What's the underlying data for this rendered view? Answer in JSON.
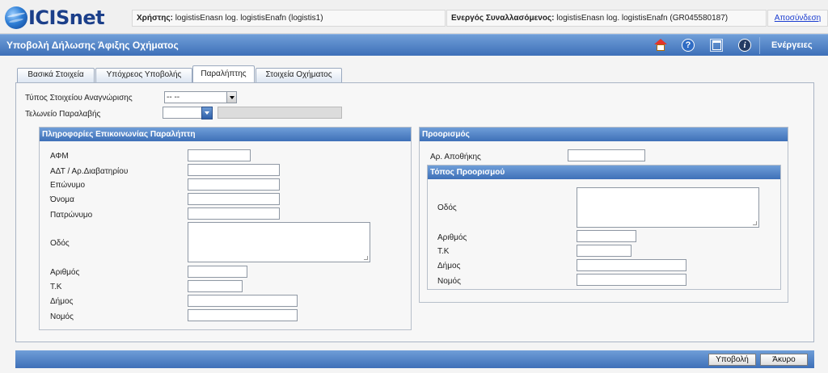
{
  "app": {
    "logo_text": "ICISnet"
  },
  "header": {
    "user_label": "Χρήστης:",
    "user_value": "logistisEnasn log. logistisEnafn (logistis1)",
    "active_label": "Ενεργός Συναλλασόμενος:",
    "active_value": "logistisEnasn log. logistisEnafn (GR045580187)",
    "logout": "Αποσύνδεση"
  },
  "titlebar": {
    "title": "Υποβολή Δήλωσης Άφιξης Οχήματος",
    "actions": "Ενέργειες",
    "icons": [
      "home-icon",
      "help-icon",
      "window-icon",
      "info-icon"
    ]
  },
  "tabs": [
    {
      "label": "Βασικά Στοιχεία",
      "selected": false
    },
    {
      "label": "Υπόχρεος Υποβολής",
      "selected": false
    },
    {
      "label": "Παραλήπτης",
      "selected": true
    },
    {
      "label": "Στοιχεία Οχήματος",
      "selected": false
    }
  ],
  "top_fields": {
    "id_type_label": "Τύπος Στοιχείου Αναγνώρισης",
    "id_type_value": "-- --",
    "customs_label": "Τελωνείο Παραλαβής",
    "customs_value": ""
  },
  "recipient_contact": {
    "title": "Πληροφορίες Επικοινωνίας Παραλήπτη",
    "afm": "ΑΦΜ",
    "adt": "ΑΔΤ / Αρ.Διαβατηρίου",
    "surname": "Επώνυμο",
    "name": "Όνομα",
    "father": "Πατρώνυμο",
    "street": "Οδός",
    "number": "Αριθμός",
    "zip": "Τ.Κ",
    "municipality": "Δήμος",
    "prefecture": "Νομός"
  },
  "destination": {
    "title": "Προορισμός",
    "warehouse": "Αρ. Αποθήκης",
    "place_title": "Τόπος Προορισμού",
    "street": "Οδός",
    "number": "Αριθμός",
    "zip": "Τ.Κ",
    "municipality": "Δήμος",
    "prefecture": "Νομός"
  },
  "footer": {
    "submit": "Υποβολή",
    "cancel": "Άκυρο"
  },
  "colors": {
    "header_blue": "#3e70b8",
    "link": "#1a3cd0"
  }
}
